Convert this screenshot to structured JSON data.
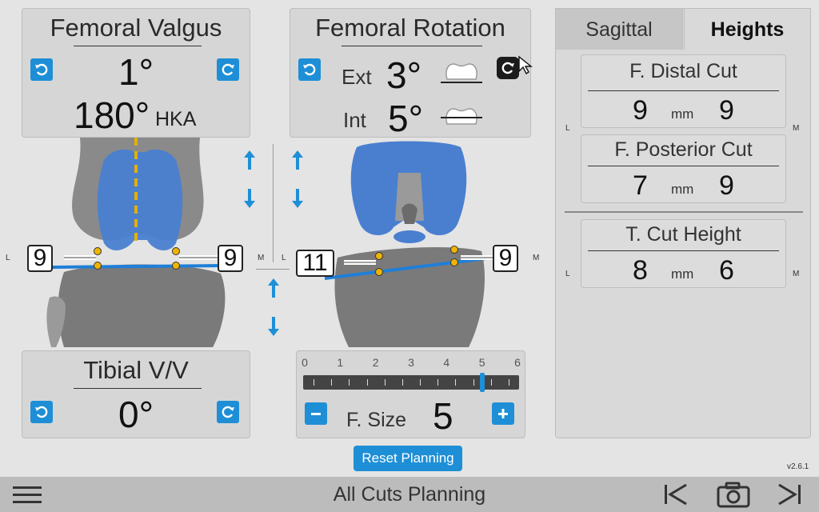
{
  "valgus": {
    "title": "Femoral Valgus",
    "value": "1°",
    "hka_value": "180°",
    "hka_label": "HKA"
  },
  "rotation": {
    "title": "Femoral Rotation",
    "ext_label": "Ext",
    "ext_value": "3°",
    "int_label": "Int",
    "int_value": "5°"
  },
  "tibial": {
    "title": "Tibial V/V",
    "value": "0°"
  },
  "size": {
    "ticks": [
      "0",
      "1",
      "2",
      "3",
      "4",
      "5",
      "6"
    ],
    "label": "F. Size",
    "value": "5",
    "selected": 5
  },
  "left_view": {
    "lateral_label": "L",
    "medial_label": "M",
    "lateral_gap": "9",
    "medial_gap": "9"
  },
  "right_view": {
    "lateral_label": "L",
    "medial_label": "M",
    "lateral_gap": "11",
    "medial_gap": "9"
  },
  "tabs": [
    {
      "label": "Sagittal"
    },
    {
      "label": "Heights"
    }
  ],
  "heights": {
    "lateral_label": "L",
    "medial_label": "M",
    "unit": "mm",
    "cards": [
      {
        "title": "F. Distal Cut",
        "lateral": "9",
        "medial": "9"
      },
      {
        "title": "F. Posterior Cut",
        "lateral": "7",
        "medial": "9"
      },
      {
        "title": "T. Cut Height",
        "lateral": "8",
        "medial": "6"
      }
    ]
  },
  "reset_label": "Reset Planning",
  "version": "v2.6.1",
  "footer_title": "All Cuts Planning",
  "colors": {
    "accent": "#1e8fd6",
    "implant": "#4a7fd0",
    "bone": "#8c8c8c",
    "cut_line": "#1e7fd8",
    "marker": "#f0b400"
  },
  "icons": [
    "menu-icon",
    "rotate-ccw-icon",
    "rotate-cw-icon",
    "arrow-up-icon",
    "arrow-down-icon",
    "minus-icon",
    "plus-icon",
    "skip-back-icon",
    "camera-icon",
    "skip-forward-icon"
  ]
}
